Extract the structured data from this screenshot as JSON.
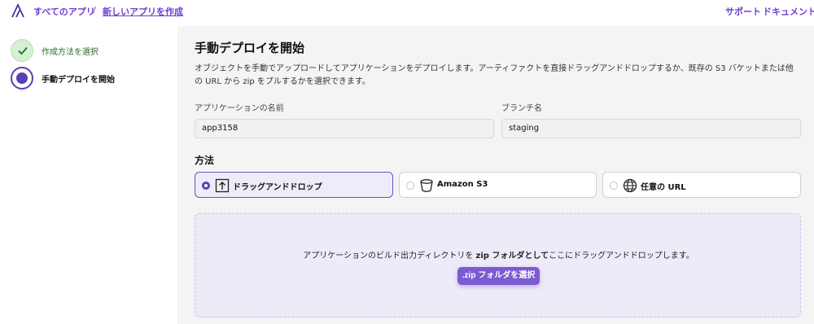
{
  "header": {
    "breadcrumb": [
      "すべてのアプリ",
      "新しいアプリを作成"
    ],
    "separator": "/",
    "links": {
      "support": "サポート",
      "docs": "ドキュメント"
    }
  },
  "sidebar": {
    "steps": [
      {
        "label": "作成方法を選択",
        "state": "complete"
      },
      {
        "label": "手動デプロイを開始",
        "state": "current"
      }
    ]
  },
  "main": {
    "title": "手動デプロイを開始",
    "description": "オブジェクトを手動でアップロードしてアプリケーションをデプロイします。アーティファクトを直接ドラッグアンドドロップするか、既存の S3 バケットまたは他の URL から zip をプルするかを選択できます。",
    "app_name": {
      "label": "アプリケーションの名前",
      "value": "app3158"
    },
    "branch": {
      "label": "ブランチ名",
      "value": "staging"
    },
    "method": {
      "title": "方法",
      "options": [
        {
          "label": "ドラッグアンドドロップ",
          "icon": "upload-icon",
          "selected": true
        },
        {
          "label": "Amazon S3",
          "icon": "bucket-icon",
          "selected": false
        },
        {
          "label": "任意の URL",
          "icon": "globe-icon",
          "selected": false
        }
      ]
    },
    "dropzone": {
      "text_before": "アプリケーションのビルド出力ディレクトリを ",
      "text_bold": "zip フォルダとして",
      "text_after": "ここにドラッグアンドドロップします。",
      "button": ".zip フォルダを選択"
    }
  },
  "colors": {
    "accent": "#5a3fb8",
    "button": "#7b5ad2",
    "complete": "#d7f0d3"
  }
}
